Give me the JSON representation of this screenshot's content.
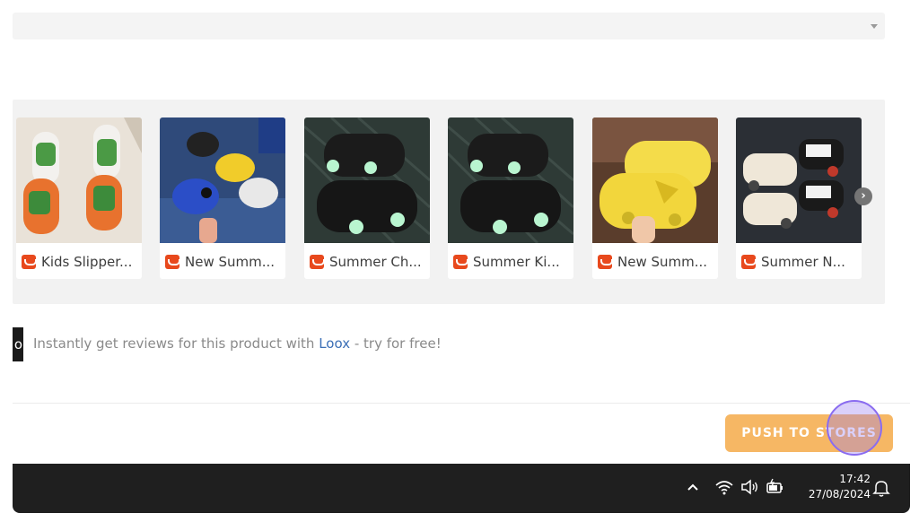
{
  "select": {
    "value": ""
  },
  "carousel": {
    "items": [
      {
        "title": "Kids Slipper...",
        "store_icon": "aliexpress-icon"
      },
      {
        "title": "New Summ...",
        "store_icon": "aliexpress-icon"
      },
      {
        "title": "Summer Ch...",
        "store_icon": "aliexpress-icon"
      },
      {
        "title": "Summer Ki...",
        "store_icon": "aliexpress-icon"
      },
      {
        "title": "New Summ...",
        "store_icon": "aliexpress-icon"
      },
      {
        "title": "Summer N...",
        "store_icon": "aliexpress-icon"
      }
    ],
    "next_icon": "chevron-right-icon"
  },
  "loox": {
    "mark": "o",
    "prefix": "Instantly get reviews for this product with ",
    "link": "Loox",
    "suffix": " - try for free!"
  },
  "push_button": {
    "label": "PUSH TO STORES",
    "color": "#f6b764"
  },
  "taskbar": {
    "time": "17:42",
    "date": "27/08/2024",
    "icons": [
      "chevron-up-icon",
      "wifi-icon",
      "speaker-icon",
      "battery-icon",
      "bell-icon"
    ]
  },
  "colors": {
    "accent": "#f6b764",
    "link": "#3b6fb6",
    "taskbar": "#1f1f1f",
    "click_indicator": "#8a6cf0"
  }
}
